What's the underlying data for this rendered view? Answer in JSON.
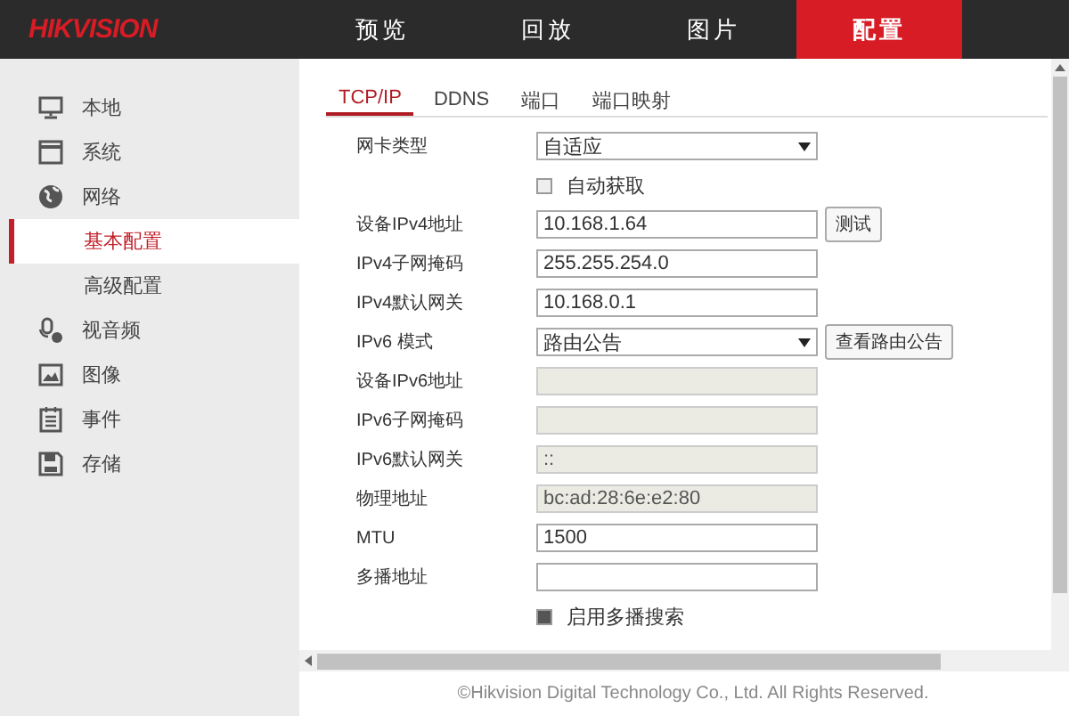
{
  "header": {
    "logo": "HIKVISION",
    "nav": [
      {
        "label": "预览",
        "selected": false
      },
      {
        "label": "回放",
        "selected": false
      },
      {
        "label": "图片",
        "selected": false
      },
      {
        "label": "配置",
        "selected": true
      }
    ]
  },
  "sidebar": {
    "items": [
      {
        "label": "本地"
      },
      {
        "label": "系统"
      },
      {
        "label": "网络",
        "children": [
          {
            "label": "基本配置",
            "selected": true
          },
          {
            "label": "高级配置",
            "selected": false
          }
        ]
      },
      {
        "label": "视音频"
      },
      {
        "label": "图像"
      },
      {
        "label": "事件"
      },
      {
        "label": "存储"
      }
    ]
  },
  "tabs": [
    {
      "label": "TCP/IP",
      "selected": true
    },
    {
      "label": "DDNS",
      "selected": false
    },
    {
      "label": "端口",
      "selected": false
    },
    {
      "label": "端口映射",
      "selected": false
    }
  ],
  "form": [
    {
      "kind": "select",
      "label": "网卡类型",
      "value": "自适应"
    },
    {
      "kind": "checkbox",
      "label": "自动获取",
      "checked": false
    },
    {
      "kind": "text",
      "label": "设备IPv4地址",
      "value": "10.168.1.64",
      "disabled": false,
      "button": "测试"
    },
    {
      "kind": "text",
      "label": "IPv4子网掩码",
      "value": "255.255.254.0",
      "disabled": false
    },
    {
      "kind": "text",
      "label": "IPv4默认网关",
      "value": "10.168.0.1",
      "disabled": false
    },
    {
      "kind": "select",
      "label": "IPv6 模式",
      "value": "路由公告",
      "button": "查看路由公告"
    },
    {
      "kind": "text",
      "label": "设备IPv6地址",
      "disabled": true
    },
    {
      "kind": "text",
      "label": "IPv6子网掩码",
      "disabled": true
    },
    {
      "kind": "text",
      "label": "IPv6默认网关",
      "value": "::",
      "disabled": true
    },
    {
      "kind": "text",
      "label": "物理地址",
      "value": "bc:ad:28:6e:e2:80",
      "disabled": true
    },
    {
      "kind": "text",
      "label": "MTU",
      "value": "1500",
      "disabled": false
    },
    {
      "kind": "text",
      "label": "多播地址",
      "disabled": false
    },
    {
      "kind": "checkbox",
      "label": "启用多播搜索",
      "checked": true
    }
  ],
  "footer": {
    "copyright": "©Hikvision Digital Technology Co., Ltd. All Rights Reserved."
  }
}
